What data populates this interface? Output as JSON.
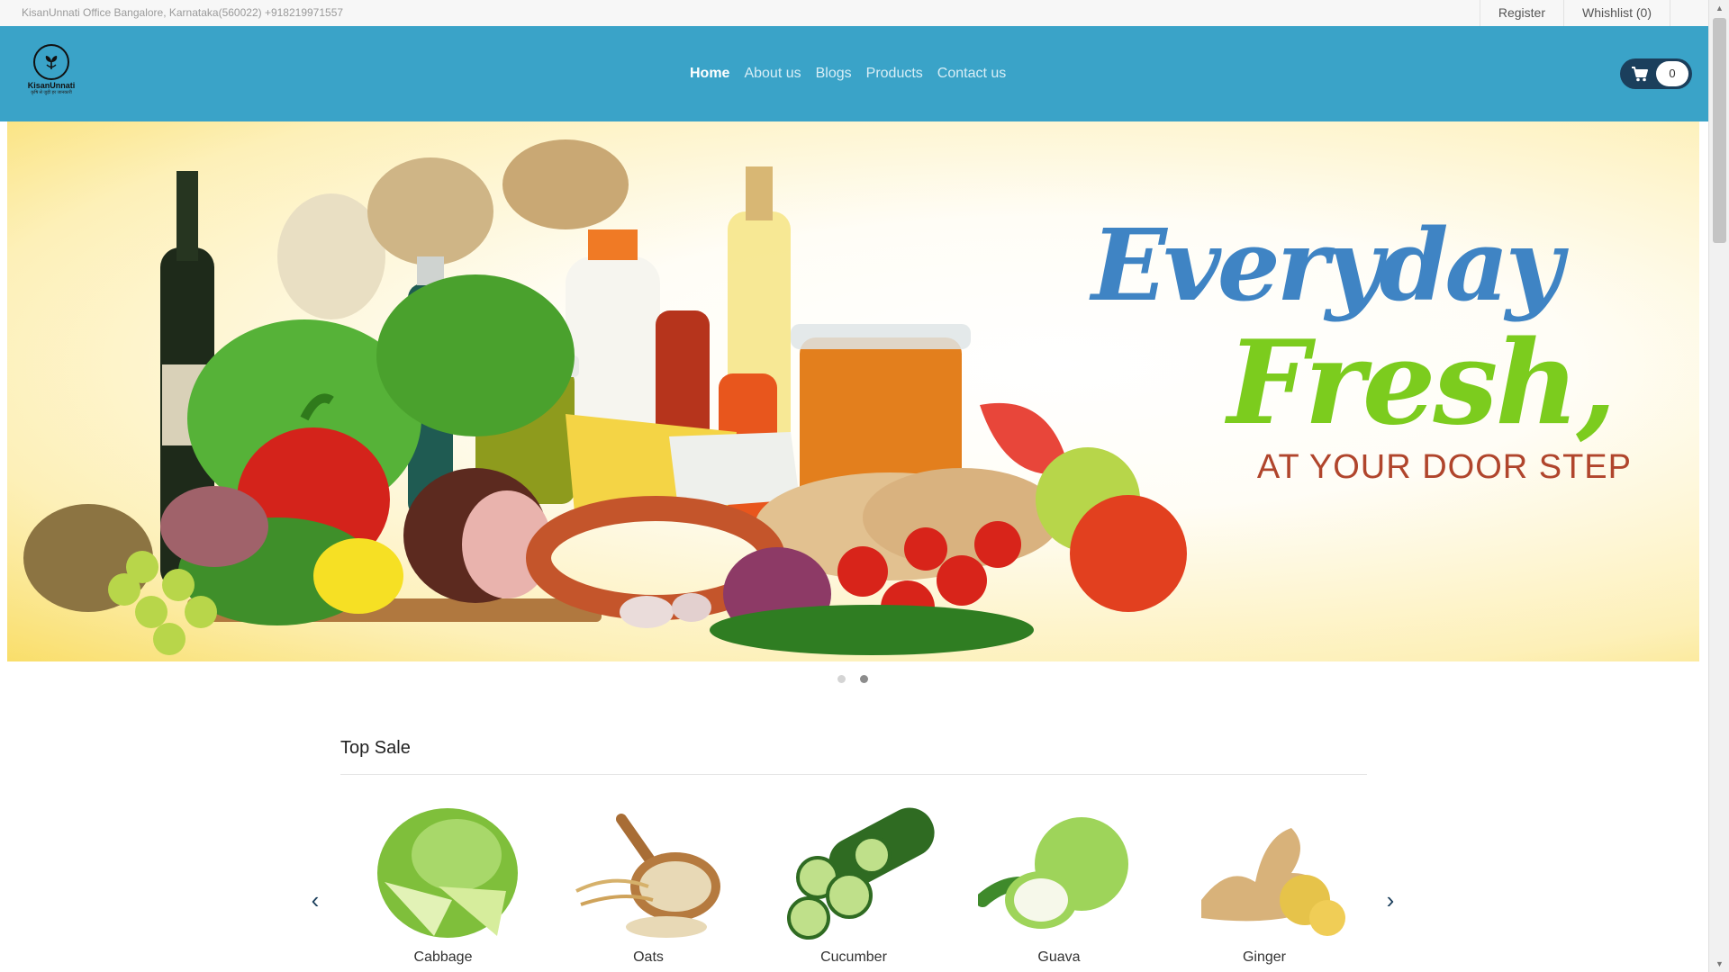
{
  "topbar": {
    "address": "KisanUnnati Office Bangalore, Karnataka(560022) +918219971557",
    "register": "Register",
    "wishlist": "Whishlist (0)"
  },
  "header": {
    "logo_name": "KisanUnnati",
    "logo_tagline": "कृषि से जुड़ी हर जानकारी",
    "nav": [
      "Home",
      "About us",
      "Blogs",
      "Products",
      "Contact us"
    ],
    "active_nav": "Home",
    "cart_count": "0",
    "bg_color": "#3aa3c8",
    "cart_color": "#1b3f5c"
  },
  "banner": {
    "line1": "Everyday",
    "line2": "Fresh,",
    "line3": "AT YOUR DOOR STEP",
    "slide_count": 2,
    "active_slide": 2
  },
  "top_sale": {
    "title": "Top Sale",
    "prev_icon": "‹",
    "next_icon": "›",
    "products": [
      {
        "name": "Cabbage",
        "icon": "cabbage-image"
      },
      {
        "name": "Oats",
        "icon": "oats-image"
      },
      {
        "name": "Cucumber",
        "icon": "cucumber-image"
      },
      {
        "name": "Guava",
        "icon": "guava-image"
      },
      {
        "name": "Ginger",
        "icon": "ginger-image"
      }
    ]
  }
}
